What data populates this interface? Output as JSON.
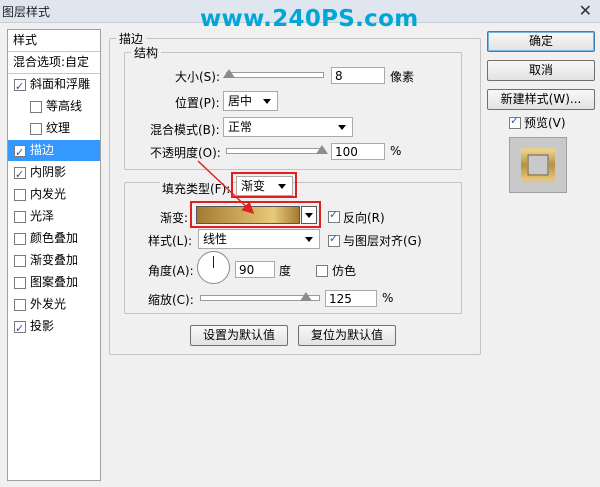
{
  "window": {
    "title": "图层样式",
    "close_glyph": "✕"
  },
  "watermark": "www.240PS.com",
  "left_panel": {
    "header": "样式",
    "blend_options": "混合选项:自定",
    "items": [
      {
        "label": "斜面和浮雕",
        "checked": true,
        "indent": false
      },
      {
        "label": "等高线",
        "checked": false,
        "indent": true
      },
      {
        "label": "纹理",
        "checked": false,
        "indent": true
      },
      {
        "label": "描边",
        "checked": true,
        "indent": false,
        "selected": true
      },
      {
        "label": "内阴影",
        "checked": true,
        "indent": false
      },
      {
        "label": "内发光",
        "checked": false,
        "indent": false
      },
      {
        "label": "光泽",
        "checked": false,
        "indent": false
      },
      {
        "label": "颜色叠加",
        "checked": false,
        "indent": false
      },
      {
        "label": "渐变叠加",
        "checked": false,
        "indent": false
      },
      {
        "label": "图案叠加",
        "checked": false,
        "indent": false
      },
      {
        "label": "外发光",
        "checked": false,
        "indent": false
      },
      {
        "label": "投影",
        "checked": true,
        "indent": false
      }
    ]
  },
  "stroke": {
    "section_title": "描边",
    "structure": {
      "title": "结构",
      "size_label": "大小(S):",
      "size_value": "8",
      "size_unit": "像素",
      "size_fraction": 0.03,
      "position_label": "位置(P):",
      "position_value": "居中",
      "blend_label": "混合模式(B):",
      "blend_value": "正常",
      "opacity_label": "不透明度(O):",
      "opacity_value": "100",
      "opacity_unit": "%",
      "opacity_fraction": 1.0
    },
    "fill": {
      "fill_type_label": "填充类型(F):",
      "fill_type_value": "渐变",
      "gradient_label": "渐变:",
      "gradient_colors": [
        "#a37a32",
        "#e9c97a",
        "#a37a32"
      ],
      "reverse_label": "反向(R)",
      "reverse_checked": true,
      "style_label": "样式(L):",
      "style_value": "线性",
      "align_label": "与图层对齐(G)",
      "align_checked": true,
      "angle_label": "角度(A):",
      "angle_value": "90",
      "angle_unit": "度",
      "dither_label": "仿色",
      "dither_checked": false,
      "scale_label": "缩放(C):",
      "scale_value": "125",
      "scale_unit": "%",
      "scale_fraction": 0.9
    },
    "make_default": "设置为默认值",
    "reset_default": "复位为默认值"
  },
  "right_panel": {
    "ok": "确定",
    "cancel": "取消",
    "new_style": "新建样式(W)...",
    "preview_label": "预览(V)",
    "preview_checked": true
  },
  "colors": {
    "accent": "#3399ff",
    "annotation_red": "#e02020",
    "watermark": "#00a6d6"
  }
}
